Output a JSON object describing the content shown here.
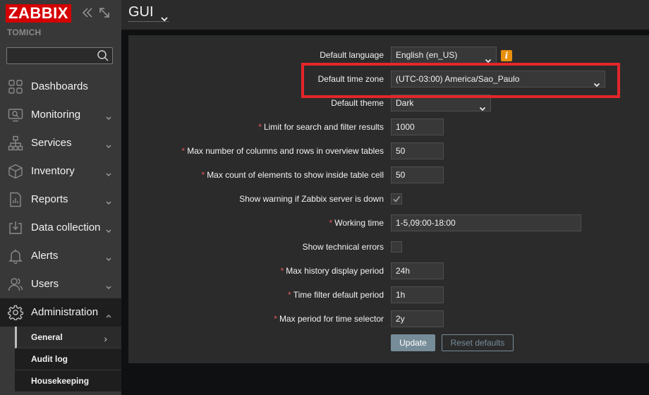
{
  "brand": {
    "logo_text": "ZABBIX",
    "server_name": "TOMICH",
    "accent": "#d40000"
  },
  "sidebar": {
    "search": {
      "value": "",
      "placeholder": ""
    },
    "items": [
      {
        "label": "Dashboards",
        "icon": "dashboards-icon"
      },
      {
        "label": "Monitoring",
        "icon": "monitoring-icon"
      },
      {
        "label": "Services",
        "icon": "services-icon"
      },
      {
        "label": "Inventory",
        "icon": "inventory-icon"
      },
      {
        "label": "Reports",
        "icon": "reports-icon"
      },
      {
        "label": "Data collection",
        "icon": "data-collection-icon"
      },
      {
        "label": "Alerts",
        "icon": "alerts-icon"
      },
      {
        "label": "Users",
        "icon": "users-icon"
      },
      {
        "label": "Administration",
        "icon": "gear-icon"
      }
    ],
    "submenu": [
      {
        "label": "General",
        "selected": true
      },
      {
        "label": "Audit log"
      },
      {
        "label": "Housekeeping"
      }
    ]
  },
  "header": {
    "title": "GUI"
  },
  "form": {
    "default_language": {
      "label": "Default language",
      "value": "English (en_US)"
    },
    "default_time_zone": {
      "label": "Default time zone",
      "value": "(UTC-03:00) America/Sao_Paulo"
    },
    "default_theme": {
      "label": "Default theme",
      "value": "Dark"
    },
    "search_limit": {
      "required": "*",
      "label": "Limit for search and filter results",
      "value": "1000"
    },
    "max_overview": {
      "required": "*",
      "label": "Max number of columns and rows in overview tables",
      "value": "50"
    },
    "max_in_table": {
      "required": "*",
      "label": "Max count of elements to show inside table cell",
      "value": "50"
    },
    "server_check": {
      "label": "Show warning if Zabbix server is down",
      "checked": true
    },
    "work_period": {
      "required": "*",
      "label": "Working time",
      "value": "1-5,09:00-18:00"
    },
    "show_technical_errors": {
      "label": "Show technical errors",
      "checked": false
    },
    "history_period": {
      "required": "*",
      "label": "Max history display period",
      "value": "24h"
    },
    "period_default": {
      "required": "*",
      "label": "Time filter default period",
      "value": "1h"
    },
    "max_period": {
      "required": "*",
      "label": "Max period for time selector",
      "value": "2y"
    },
    "update_label": "Update",
    "reset_label": "Reset defaults",
    "info_symbol": "i"
  },
  "colors": {
    "highlight": "#e3262b",
    "button": "#768d99",
    "warning": "#e8900c",
    "required": "#e45959"
  }
}
